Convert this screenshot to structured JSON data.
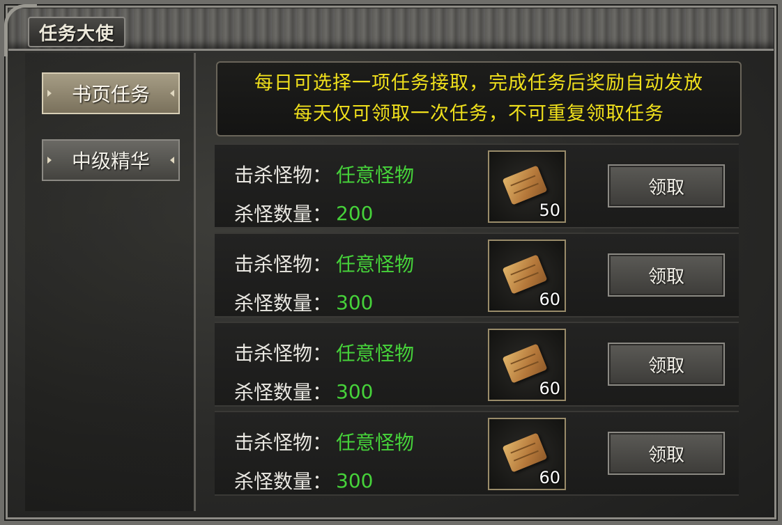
{
  "window": {
    "title": "任务大使"
  },
  "tabs": [
    {
      "label": "书页任务",
      "active": true
    },
    {
      "label": "中级精华",
      "active": false
    }
  ],
  "notice": {
    "line1": "每日可选择一项任务接取，完成任务后奖励自动发放",
    "line2": "每天仅可领取一次任务，不可重复领取任务"
  },
  "tasks": [
    {
      "monster_label": "击杀怪物：",
      "monster_value": "任意怪物",
      "count_label": "杀怪数量：",
      "count_value": "200",
      "reward_icon": "scroll-icon",
      "reward_count": "50",
      "claim_label": "领取"
    },
    {
      "monster_label": "击杀怪物：",
      "monster_value": "任意怪物",
      "count_label": "杀怪数量：",
      "count_value": "300",
      "reward_icon": "scroll-icon",
      "reward_count": "60",
      "claim_label": "领取"
    },
    {
      "monster_label": "击杀怪物：",
      "monster_value": "任意怪物",
      "count_label": "杀怪数量：",
      "count_value": "300",
      "reward_icon": "scroll-icon",
      "reward_count": "60",
      "claim_label": "领取"
    },
    {
      "monster_label": "击杀怪物：",
      "monster_value": "任意怪物",
      "count_label": "杀怪数量：",
      "count_value": "300",
      "reward_icon": "scroll-icon",
      "reward_count": "60",
      "claim_label": "领取"
    }
  ],
  "colors": {
    "notice_text": "#f0e01c",
    "value_green": "#46d23a"
  }
}
